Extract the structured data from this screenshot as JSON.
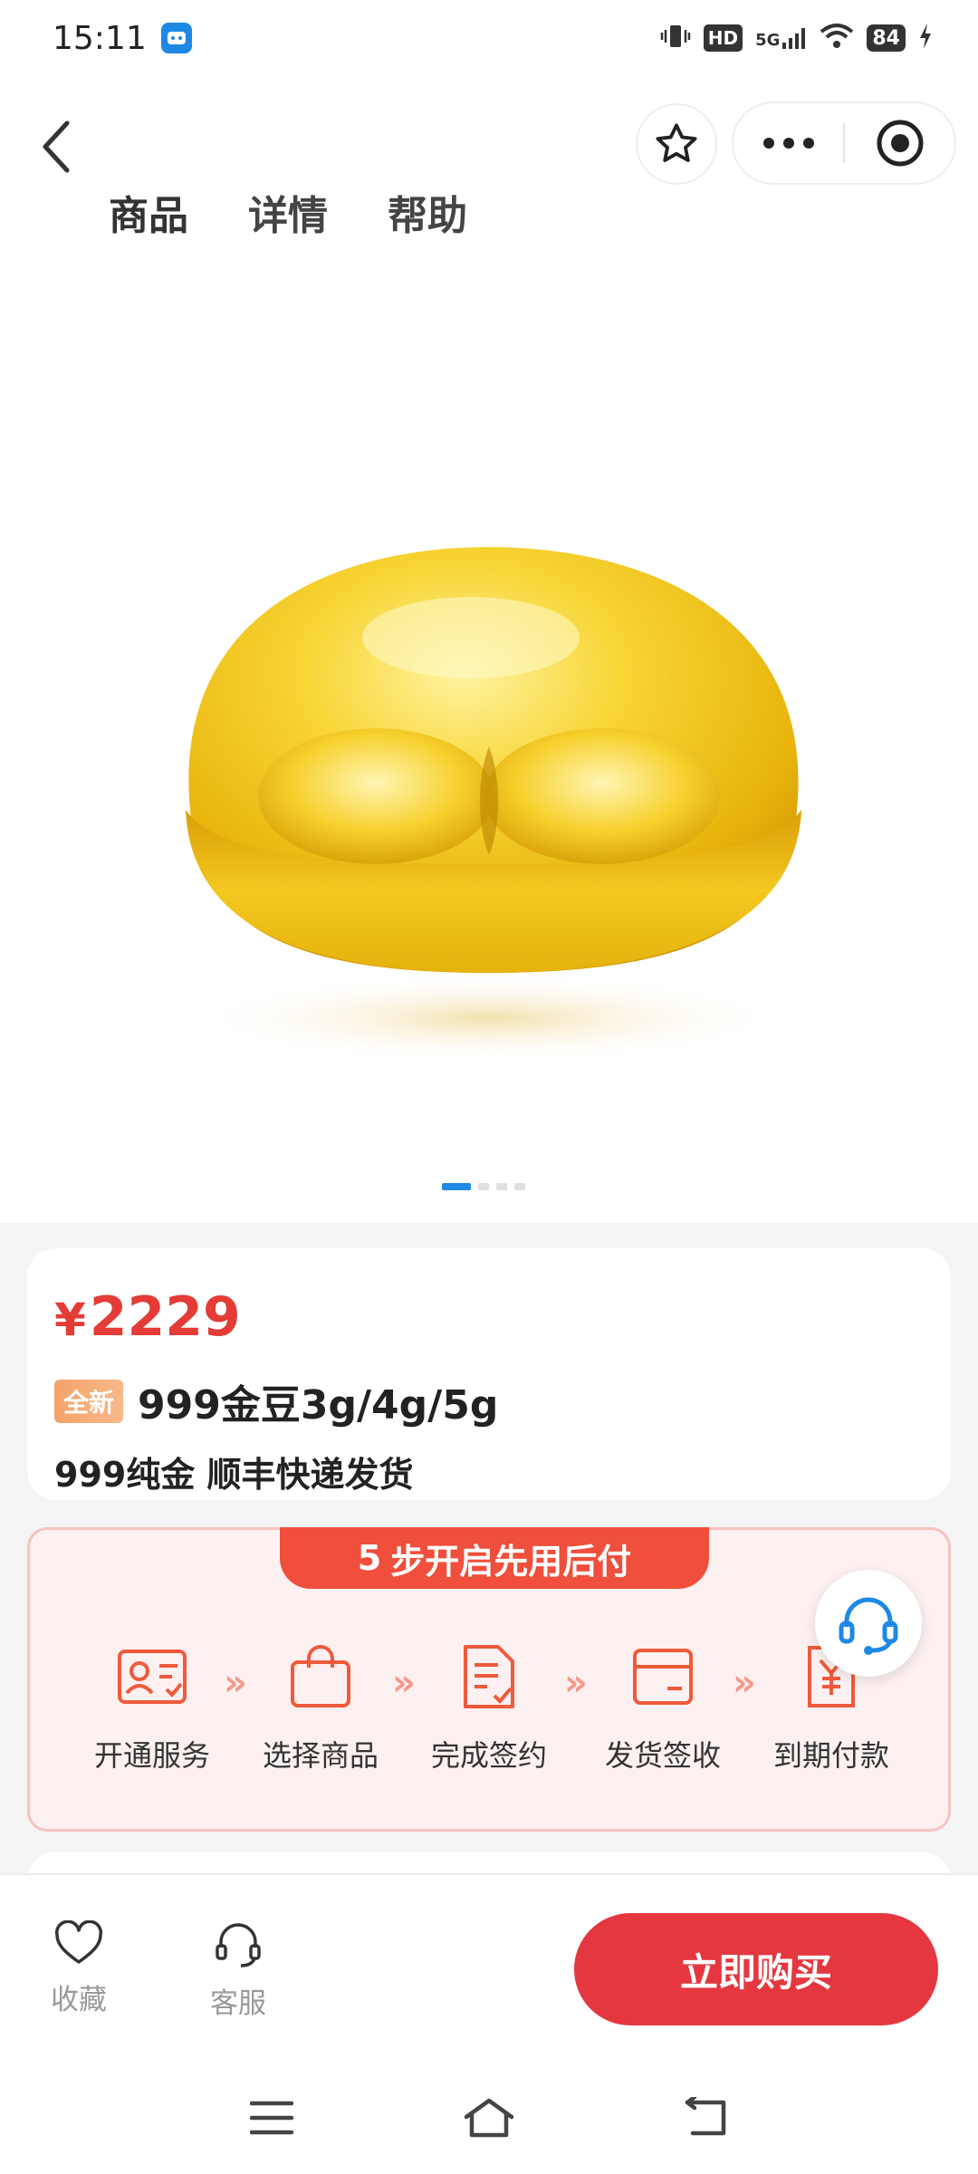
{
  "status_bar": {
    "time": "15:11",
    "network": "5G",
    "hd": "HD",
    "battery": "84"
  },
  "nav": {
    "tabs": [
      {
        "label": "商品",
        "active": true
      },
      {
        "label": "详情",
        "active": false
      },
      {
        "label": "帮助",
        "active": false
      }
    ]
  },
  "carousel": {
    "total": 4,
    "current": 1
  },
  "product": {
    "currency": "¥",
    "price": "2229",
    "tag": "全新",
    "title": "999金豆3g/4g/5g",
    "subtitle": "999纯金 顺丰快递发货"
  },
  "pay_later": {
    "banner_number": "5",
    "banner_text": "步开启先用后付",
    "steps": [
      {
        "label": "开通服务",
        "icon": "id-card-icon"
      },
      {
        "label": "选择商品",
        "icon": "shopping-bag-icon"
      },
      {
        "label": "完成签约",
        "icon": "document-sign-icon"
      },
      {
        "label": "发货签收",
        "icon": "box-icon"
      },
      {
        "label": "到期付款",
        "icon": "yuan-bill-icon"
      }
    ],
    "arrow": "»"
  },
  "bottom_bar": {
    "favorite_label": "收藏",
    "service_label": "客服",
    "buy_label": "立即购买"
  },
  "colors": {
    "accent_red": "#e4373f",
    "price_red": "#e43b36",
    "steps_orange": "#ef4f3c",
    "carousel_blue": "#1e88e5"
  }
}
